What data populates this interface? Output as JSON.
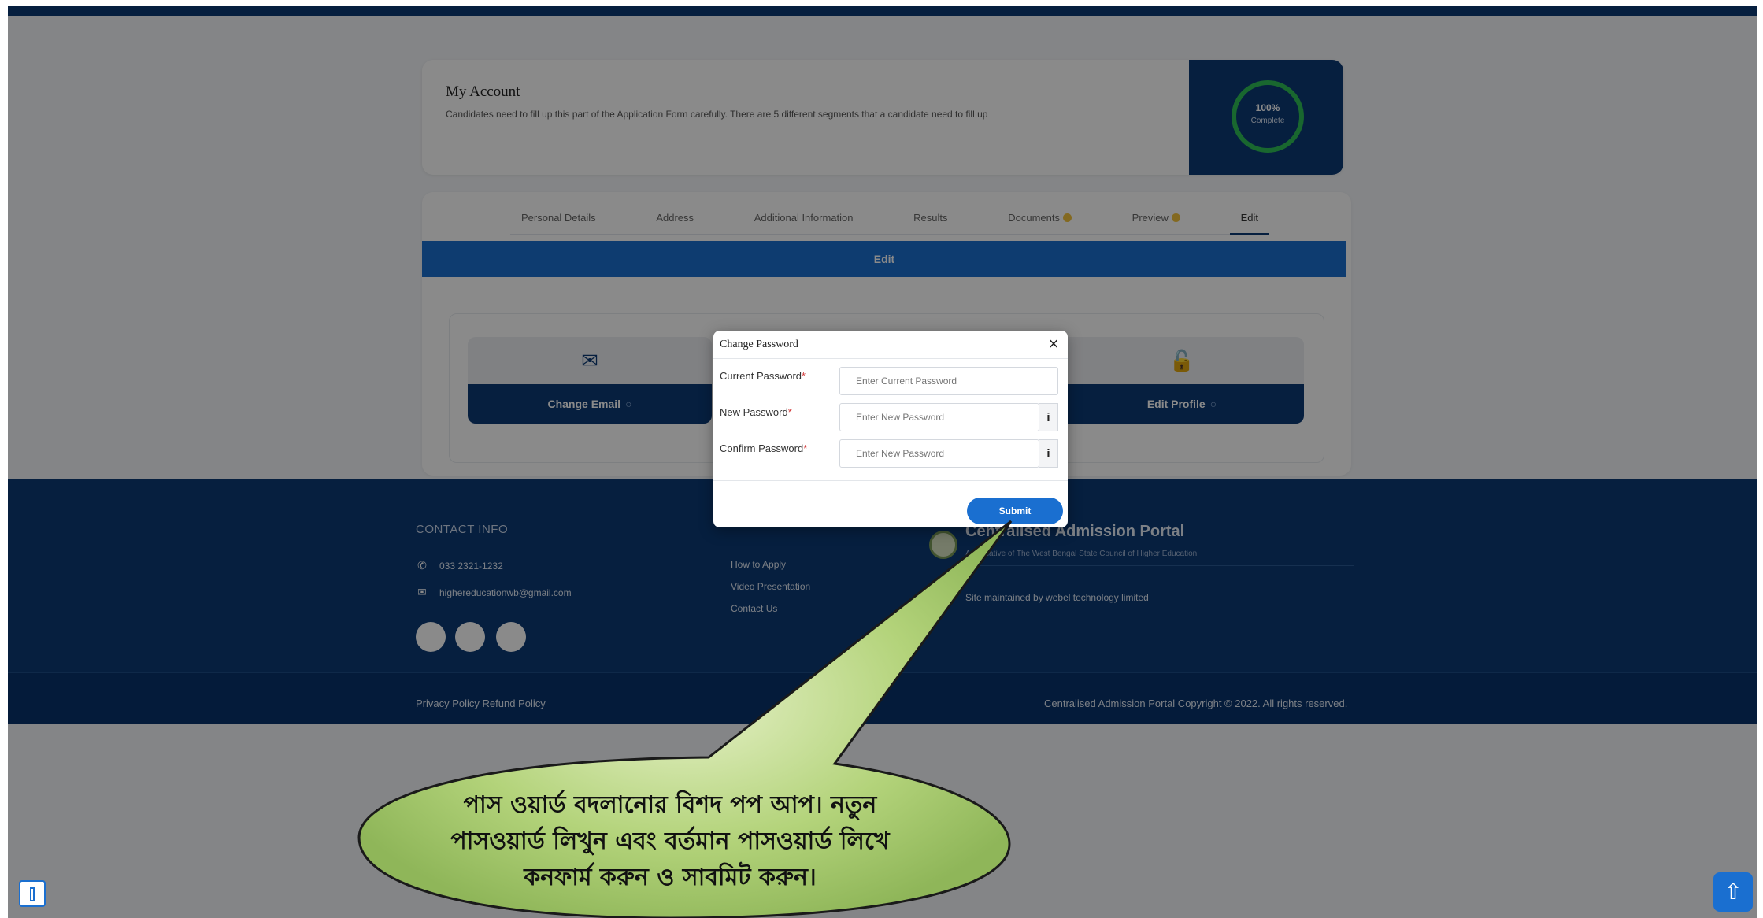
{
  "account": {
    "title": "My Account",
    "description": "Candidates need to fill up this part of the Application Form carefully. There are 5 different segments that a candidate need to fill up",
    "progress_percent": 100,
    "progress_label": "100%",
    "progress_sub": "Complete"
  },
  "tabs": [
    {
      "label": "Personal Details",
      "status": ""
    },
    {
      "label": "Address",
      "status": ""
    },
    {
      "label": "Additional Information",
      "status": ""
    },
    {
      "label": "Results",
      "status": ""
    },
    {
      "label": "Documents",
      "status": "pending"
    },
    {
      "label": "Preview",
      "status": "pending"
    },
    {
      "label": "Edit",
      "status": "active"
    }
  ],
  "edit_bar": {
    "label": "Edit"
  },
  "actions": [
    {
      "label": "Change Email",
      "icon": "envelope-icon",
      "glyph": "✉"
    },
    {
      "label": "Edit Profile",
      "icon": "unlock-icon",
      "glyph": "🔓"
    }
  ],
  "modal": {
    "title": "Change Password",
    "close_glyph": "×",
    "fields": [
      {
        "label": "Current Password",
        "placeholder": "Enter Current Password"
      },
      {
        "label": "New Password",
        "placeholder": "Enter New Password"
      },
      {
        "label": "Confirm Password",
        "placeholder": "Enter New Password"
      }
    ],
    "required_mark": "*",
    "eye_glyph": "i",
    "submit_label": "Submit"
  },
  "footer": {
    "contact_title": "CONTACT INFO",
    "phone": "033 2321-1232",
    "email": "highereducationwb@gmail.com",
    "links": [
      "How to Apply",
      "Video Presentation",
      "Contact Us"
    ],
    "portal_title": "Centralised Admission Portal",
    "portal_sub": "An initiative of The West Bengal State Council of Higher Education",
    "portal_dev": "Site maintained by webel technology limited",
    "bottom_left": "Privacy Policy  Refund Policy",
    "bottom_right": "Centralised Admission Portal Copyright © 2022. All rights reserved."
  },
  "callout": {
    "lines": [
      "পাস ওয়ার্ড বদলানোর বিশদ পপ আপ। নতুন",
      "পাসওয়ার্ড লিখুন এবং বর্তমান পাসওয়ার্ড লিখে",
      "কনফার্ম করুন ও সাবমিট করুন।"
    ],
    "fill": "#a4c96b",
    "stroke": "#222222"
  },
  "colors": {
    "primary": "#0c3a75",
    "accent": "#1a6fd0",
    "success": "#2fbf57",
    "warning": "#f3c33c"
  }
}
